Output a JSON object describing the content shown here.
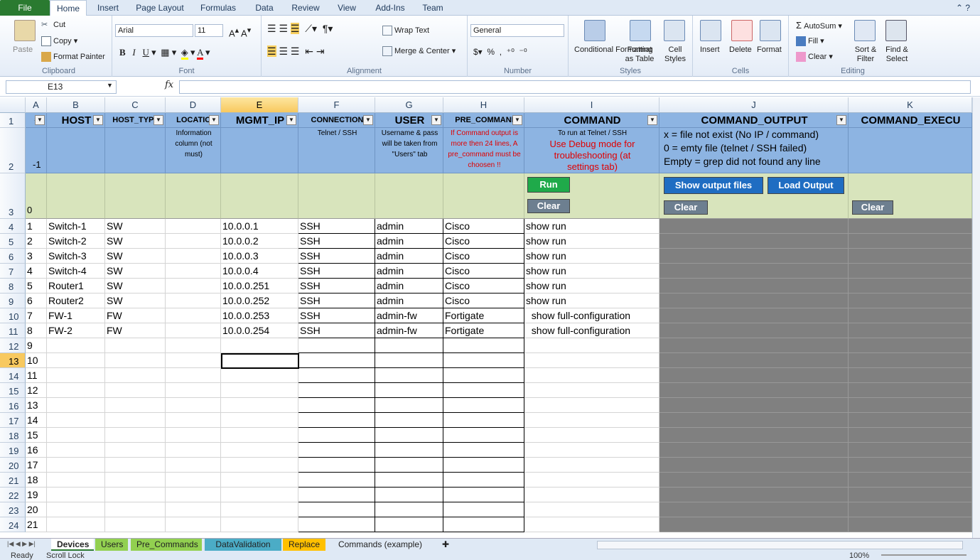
{
  "menu_tabs": [
    "File",
    "Home",
    "Insert",
    "Page Layout",
    "Formulas",
    "Data",
    "Review",
    "View",
    "Add-Ins",
    "Team"
  ],
  "ribbon": {
    "clipboard": {
      "label": "Clipboard",
      "paste": "Paste",
      "cut": "Cut",
      "copy": "Copy",
      "format_painter": "Format Painter"
    },
    "font": {
      "label": "Font",
      "name": "Arial",
      "size": "11"
    },
    "alignment": {
      "label": "Alignment",
      "wrap_text": "Wrap Text",
      "merge_center": "Merge & Center"
    },
    "number": {
      "label": "Number",
      "format": "General",
      "percent": "%",
      "comma": ","
    },
    "styles": {
      "label": "Styles",
      "conditional": "Conditional Formatting",
      "format_table": "Format as Table",
      "cell_styles": "Cell Styles"
    },
    "cells": {
      "label": "Cells",
      "insert": "Insert",
      "delete": "Delete",
      "format": "Format"
    },
    "editing": {
      "label": "Editing",
      "autosum": "AutoSum",
      "fill": "Fill",
      "clear": "Clear",
      "sort": "Sort & Filter",
      "find": "Find & Select"
    }
  },
  "formula_bar": {
    "name_box": "E13",
    "fx": "fx",
    "value": ""
  },
  "columns": [
    "A",
    "B",
    "C",
    "D",
    "E",
    "F",
    "G",
    "H",
    "I",
    "J",
    "K"
  ],
  "row_numbers": [
    "1",
    "2",
    "3",
    "4",
    "5",
    "6",
    "7",
    "8",
    "9",
    "10",
    "11",
    "12",
    "13",
    "14",
    "15",
    "16",
    "17",
    "18",
    "19",
    "20",
    "21",
    "22",
    "23",
    "24"
  ],
  "headers": [
    "#",
    "HOST",
    "HOST_TYPE",
    "LOCATIO",
    "MGMT_IP",
    "CONNECTION",
    "USER",
    "PRE_COMMANI",
    "COMMAND",
    "COMMAND_OUTPUT",
    "COMMAND_EXECU"
  ],
  "row2": {
    "a": "-1",
    "d": "Information column (not must)",
    "f": "Telnet / SSH",
    "g": "Username & pass will be taken from \"Users\" tab",
    "h": "If Command output is more then 24 lines, A pre_command must be choosen !!",
    "i1": "To run at Telnet / SSH",
    "i2": "Use Debug mode for troubleshooting (at settings tab)",
    "j": [
      "x = file not exist (No IP / command)",
      "0 = emty file (telnet / SSH failed)",
      "Empty = grep did not found any line"
    ]
  },
  "row3": {
    "a": "0",
    "run": "Run",
    "clear_i": "Clear",
    "show_output": "Show output files",
    "load_output": "Load Output",
    "clear_j": "Clear",
    "clear_k": "Clear"
  },
  "devices": [
    {
      "n": "1",
      "host": "Switch-1",
      "type": "SW",
      "ip": "10.0.0.1",
      "conn": "SSH",
      "user": "admin",
      "pre": "Cisco",
      "cmd": "show run"
    },
    {
      "n": "2",
      "host": "Switch-2",
      "type": "SW",
      "ip": "10.0.0.2",
      "conn": "SSH",
      "user": "admin",
      "pre": "Cisco",
      "cmd": "show run"
    },
    {
      "n": "3",
      "host": "Switch-3",
      "type": "SW",
      "ip": "10.0.0.3",
      "conn": "SSH",
      "user": "admin",
      "pre": "Cisco",
      "cmd": "show run"
    },
    {
      "n": "4",
      "host": "Switch-4",
      "type": "SW",
      "ip": "10.0.0.4",
      "conn": "SSH",
      "user": "admin",
      "pre": "Cisco",
      "cmd": "show run"
    },
    {
      "n": "5",
      "host": "Router1",
      "type": "SW",
      "ip": "10.0.0.251",
      "conn": "SSH",
      "user": "admin",
      "pre": "Cisco",
      "cmd": "show run"
    },
    {
      "n": "6",
      "host": "Router2",
      "type": "SW",
      "ip": "10.0.0.252",
      "conn": "SSH",
      "user": "admin",
      "pre": "Cisco",
      "cmd": "show run"
    },
    {
      "n": "7",
      "host": "FW-1",
      "type": "FW",
      "ip": "10.0.0.253",
      "conn": "SSH",
      "user": "admin-fw",
      "pre": "Fortigate",
      "cmd": "  show full-configuration"
    },
    {
      "n": "8",
      "host": "FW-2",
      "type": "FW",
      "ip": "10.0.0.254",
      "conn": "SSH",
      "user": "admin-fw",
      "pre": "Fortigate",
      "cmd": "  show full-configuration"
    }
  ],
  "empty_row_numbers": [
    "9",
    "10",
    "11",
    "12",
    "13",
    "14",
    "15",
    "16",
    "17",
    "18",
    "19",
    "20",
    "21"
  ],
  "sheet_tabs": [
    {
      "label": "Devices",
      "color": "#ffffff"
    },
    {
      "label": "Users",
      "color": "#92d050"
    },
    {
      "label": "Pre_Commands",
      "color": "#92d050"
    },
    {
      "label": "DataValidation",
      "color": "#4bacc6"
    },
    {
      "label": "Replace",
      "color": "#ffc000"
    },
    {
      "label": "Commands (example)",
      "color": "#dfe9f5"
    }
  ],
  "status": {
    "ready": "Ready",
    "scroll_lock": "Scroll Lock",
    "zoom": "100%"
  }
}
